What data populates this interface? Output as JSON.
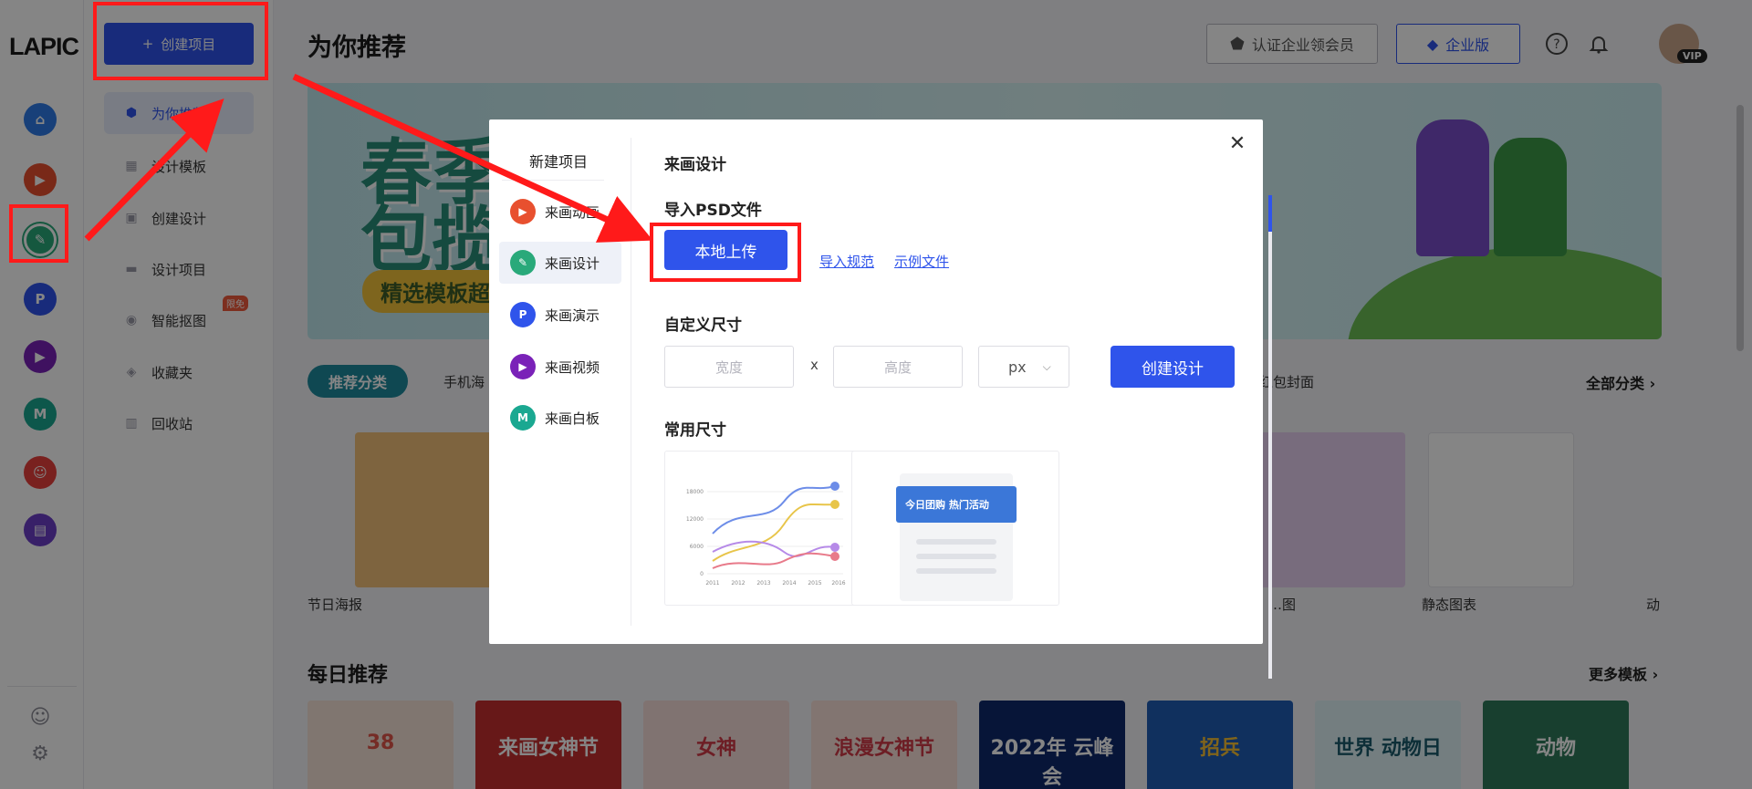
{
  "brand": {
    "logo": "LAPIC",
    "accent": "#2f54eb",
    "annotation_color": "#ff1a1a"
  },
  "rail": {
    "icons": [
      {
        "name": "home-icon",
        "color": "#2f7be8"
      },
      {
        "name": "video-icon",
        "color": "#e8502f"
      },
      {
        "name": "design-icon",
        "color": "#29a97a"
      },
      {
        "name": "present-icon",
        "color": "#2f54eb"
      },
      {
        "name": "video-purple-icon",
        "color": "#7a22b8"
      },
      {
        "name": "whiteboard-icon",
        "color": "#1aa891"
      },
      {
        "name": "team-icon",
        "color": "#e8403c"
      },
      {
        "name": "toolbox-icon",
        "color": "#6b3fc7"
      }
    ]
  },
  "nav": {
    "create_label": "创建项目",
    "items": [
      {
        "label": "为你推荐",
        "icon": "recommend-icon"
      },
      {
        "label": "设计模板",
        "icon": "template-icon"
      },
      {
        "label": "创建设计",
        "icon": "create-design-icon"
      },
      {
        "label": "设计项目",
        "icon": "folder-icon"
      },
      {
        "label": "智能抠图",
        "icon": "cutout-icon"
      },
      {
        "label": "收藏夹",
        "icon": "favorites-icon"
      },
      {
        "label": "回收站",
        "icon": "trash-icon"
      }
    ],
    "badge": "限免"
  },
  "header": {
    "title": "为你推荐",
    "auth_btn": "认证企业领会员",
    "enterprise_btn": "企业版",
    "vip": "VIP"
  },
  "banner": {
    "line1": "春季",
    "line2": "包揽",
    "pill": "精选模板超"
  },
  "categories": {
    "active": "推荐分类",
    "items": [
      "手机海",
      "红包封面"
    ],
    "all": "全部分类"
  },
  "templates": [
    "节日海报",
    "…图",
    "静态图表",
    "动"
  ],
  "daily": {
    "title": "每日推荐",
    "more": "更多模板",
    "cards": [
      {
        "text": "38",
        "color": "#f6e2d6"
      },
      {
        "text": "来画女神节",
        "color": "#c62e2e"
      },
      {
        "text": "女神",
        "color": "#f6dcd8"
      },
      {
        "text": "浪漫女神节",
        "color": "#f9e1d9"
      },
      {
        "text": "2022年 云峰会",
        "color": "#0e2a6b"
      },
      {
        "text": "招兵",
        "color": "#1f5db5"
      },
      {
        "text": "世界 动物日",
        "color": "#dff1f6"
      },
      {
        "text": "动物",
        "color": "#2f7a5a"
      }
    ]
  },
  "modal": {
    "side_title": "新建项目",
    "items": [
      {
        "label": "来画动画",
        "icon": "video-icon",
        "color": "#e8502f"
      },
      {
        "label": "来画设计",
        "icon": "design-icon",
        "color": "#29a97a"
      },
      {
        "label": "来画演示",
        "icon": "present-icon",
        "color": "#2f54eb"
      },
      {
        "label": "来画视频",
        "icon": "video-purple-icon",
        "color": "#7a22b8"
      },
      {
        "label": "来画白板",
        "icon": "whiteboard-icon",
        "color": "#1aa891"
      }
    ],
    "section_title": "来画设计",
    "import_title": "导入PSD文件",
    "upload_label": "本地上传",
    "link_spec": "导入规范",
    "link_example": "示例文件",
    "custom_title": "自定义尺寸",
    "width_placeholder": "宽度",
    "times": "x",
    "height_placeholder": "高度",
    "unit": "px",
    "create_label": "创建设计",
    "common_title": "常用尺寸",
    "chart_ticks_y": [
      "18000",
      "12000",
      "6000",
      "0"
    ],
    "chart_ticks_x": [
      "2011",
      "2012",
      "2013",
      "2014",
      "2015",
      "2016"
    ],
    "thumb2_text": "今日团购 热门活动"
  }
}
